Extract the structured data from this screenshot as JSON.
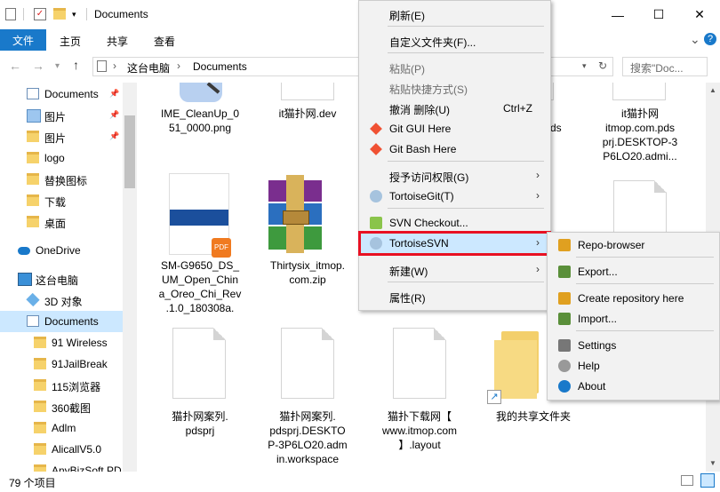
{
  "window": {
    "title": "Documents",
    "controls": {
      "minimize": "—",
      "maximize": "☐",
      "close": "✕"
    }
  },
  "ribbon": {
    "file": "文件",
    "tabs": [
      "主页",
      "共享",
      "查看"
    ],
    "expand": "⌄",
    "help": "?"
  },
  "address": {
    "path": [
      "这台电脑",
      "Documents"
    ],
    "search_placeholder": "搜索\"Doc..."
  },
  "nav": {
    "items": [
      {
        "label": "Documents",
        "pinned": true,
        "icon": "document-folder-icon"
      },
      {
        "label": "图片",
        "pinned": true,
        "icon": "picture-folder-icon"
      },
      {
        "label": "图片",
        "pinned": true,
        "icon": "folder-icon"
      },
      {
        "label": "logo",
        "pinned": false,
        "icon": "folder-icon"
      },
      {
        "label": "替换图标",
        "pinned": false,
        "icon": "folder-icon"
      },
      {
        "label": "下载",
        "pinned": false,
        "icon": "folder-icon"
      },
      {
        "label": "桌面",
        "pinned": false,
        "icon": "folder-icon"
      },
      {
        "label": "OneDrive",
        "pinned": false,
        "icon": "cloud-icon"
      },
      {
        "label": "这台电脑",
        "pinned": false,
        "icon": "computer-icon"
      },
      {
        "label": "3D 对象",
        "pinned": false,
        "icon": "cube-icon"
      },
      {
        "label": "Documents",
        "pinned": false,
        "icon": "document-folder-icon",
        "selected": true
      },
      {
        "label": "91 Wireless",
        "pinned": false,
        "icon": "folder-icon"
      },
      {
        "label": "91JailBreak",
        "pinned": false,
        "icon": "folder-icon"
      },
      {
        "label": "115浏览器",
        "pinned": false,
        "icon": "folder-icon"
      },
      {
        "label": "360截图",
        "pinned": false,
        "icon": "folder-icon"
      },
      {
        "label": "Adlm",
        "pinned": false,
        "icon": "folder-icon"
      },
      {
        "label": "AlicallV5.0",
        "pinned": false,
        "icon": "folder-icon"
      },
      {
        "label": "AnyBizSoft PD",
        "pinned": false,
        "icon": "folder-icon"
      }
    ]
  },
  "files": [
    {
      "label": "IME_CleanUp_0\n51_0000.png",
      "icon": "image-file-icon"
    },
    {
      "label": "it猫扑网.dev",
      "icon": "blank-file-icon"
    },
    {
      "label": "ods",
      "icon": "blank-file-icon"
    },
    {
      "label": "it猫扑网\nitmop.com.pds\nprj.DESKTOP-3\nP6LO20.admi...",
      "icon": "blank-file-icon"
    },
    {
      "label": "SM-G9650_DS_\nUM_Open_Chin\na_Oreo_Chi_Rev\n.1.0_180308a.",
      "icon": "pdf-file-icon"
    },
    {
      "label": "Thirtysix_itmop.\ncom.zip",
      "icon": "winrar-archive-icon"
    },
    {
      "label": "猫扑网案列.\npdsprj",
      "icon": "blank-file-icon"
    },
    {
      "label": "猫扑网案列.\npdsprj.DESKTO\nP-3P6LO20.adm\nin.workspace",
      "icon": "blank-file-icon"
    },
    {
      "label": "猫扑下载网【\nwww.itmop.com\n】.layout",
      "icon": "blank-file-icon"
    },
    {
      "label": "我的共享文件夹",
      "icon": "shortcut-folder-icon"
    }
  ],
  "status": {
    "count": "79 个项目"
  },
  "context_menu": {
    "items": [
      {
        "label": "刷新(E)"
      },
      {
        "label": "自定义文件夹(F)..."
      },
      {
        "label": "粘贴(P)",
        "disabled": true
      },
      {
        "label": "粘贴快捷方式(S)",
        "disabled": true
      },
      {
        "label": "撤消 删除(U)",
        "shortcut": "Ctrl+Z"
      },
      {
        "label": "Git GUI Here",
        "icon": "git-gui-icon"
      },
      {
        "label": "Git Bash Here",
        "icon": "git-bash-icon"
      },
      {
        "label": "授予访问权限(G)",
        "submenu": true
      },
      {
        "label": "TortoiseGit(T)",
        "submenu": true,
        "icon": "tortoisegit-icon"
      },
      {
        "label": "SVN Checkout...",
        "icon": "svn-checkout-icon"
      },
      {
        "label": "TortoiseSVN",
        "submenu": true,
        "icon": "tortoisesvn-icon",
        "highlighted": true
      },
      {
        "label": "新建(W)",
        "submenu": true
      },
      {
        "label": "属性(R)"
      }
    ]
  },
  "svn_submenu": {
    "items": [
      {
        "label": "Repo-browser",
        "icon": "repo-browser-icon"
      },
      {
        "label": "Export...",
        "icon": "export-icon"
      },
      {
        "label": "Create repository here",
        "icon": "create-repo-icon"
      },
      {
        "label": "Import...",
        "icon": "import-icon"
      },
      {
        "label": "Settings",
        "icon": "settings-icon"
      },
      {
        "label": "Help",
        "icon": "help-icon"
      },
      {
        "label": "About",
        "icon": "info-icon"
      }
    ]
  },
  "colors": {
    "accent": "#1979ca",
    "highlight_box": "#e81123",
    "selected": "#cce8ff"
  }
}
